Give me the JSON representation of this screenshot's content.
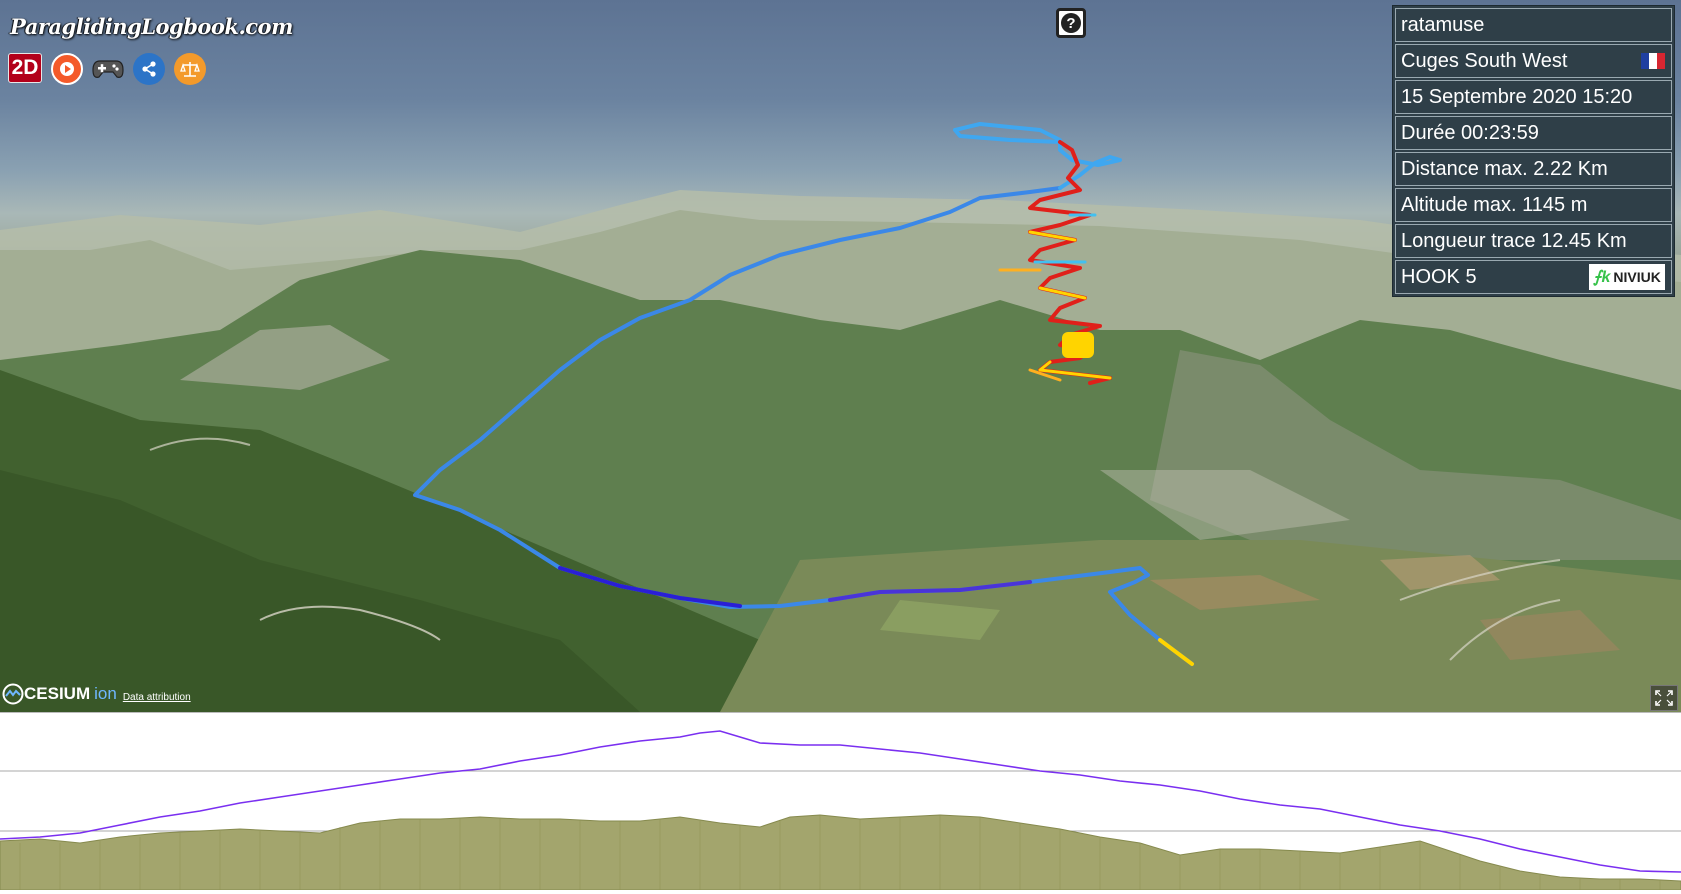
{
  "site": {
    "logo_text": "ParaglidingLogbook.com"
  },
  "toolbar": {
    "mode_label": "2D",
    "buttons": [
      "play-icon",
      "gamepad-icon",
      "share-icon",
      "scale-icon"
    ]
  },
  "help": {
    "label": "?"
  },
  "flight": {
    "pilot": "ratamuse",
    "site": "Cuges South West",
    "country_flag": "france-flag-icon",
    "date": "15 Septembre 2020 15:20",
    "duration": "Durée 00:23:59",
    "max_distance": "Distance max. 2.22 Km",
    "max_altitude": "Altitude max. 1145 m",
    "track_length": "Longueur trace 12.45 Km",
    "wing": "HOOK 5",
    "brand": "NIVIUK"
  },
  "map": {
    "credit_name": "CESIUM",
    "credit_suffix": "ion",
    "attribution": "Data attribution"
  },
  "colors": {
    "track_low": "#2a1fd6",
    "track_mid": "#3fa7f0",
    "track_warm": "#ffd400",
    "track_hot": "#e0201a",
    "altitude_line": "#7a2ff0",
    "ground_fill": "#a3a56d",
    "panel_bg": "#2f3f48"
  }
}
